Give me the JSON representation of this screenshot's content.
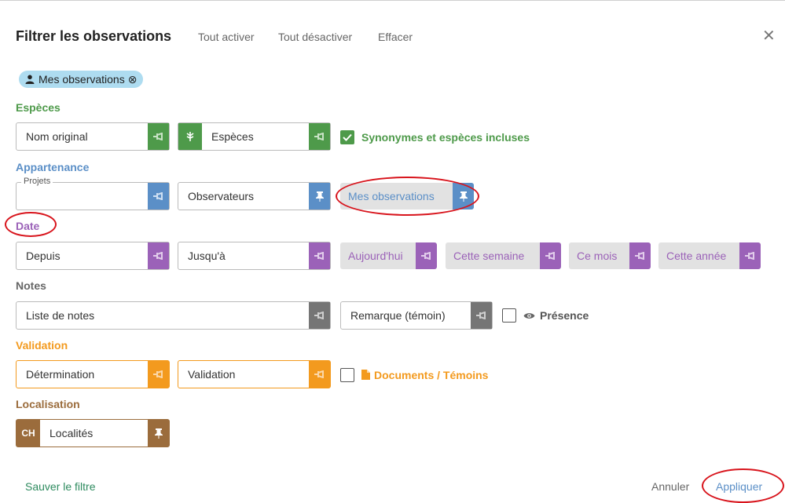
{
  "header": {
    "title": "Filtrer les observations",
    "links": [
      "Tout activer",
      "Tout désactiver",
      "Effacer"
    ],
    "close_icon": "close-icon"
  },
  "active_chip": {
    "label": "Mes observations",
    "icon": "person-icon",
    "remove_icon": "circle-x-icon"
  },
  "colors": {
    "species": "#4e9a4a",
    "membership": "#5b8fc7",
    "date": "#9b62b8",
    "notes": "#666666",
    "validation": "#f39a1e",
    "localisation": "#9b6c3c",
    "annotation_oval": "#d8141c"
  },
  "sections": {
    "especes": {
      "title": "Espèces",
      "field_original": "Nom original",
      "field_species": "Espèces",
      "checkbox_label": "Synonymes et espèces incluses",
      "checkbox_checked": true
    },
    "appartenance": {
      "title": "Appartenance",
      "field_projects_legend": "Projets",
      "field_projects_value": "",
      "field_observers": "Observateurs",
      "chip_mine": "Mes observations"
    },
    "date": {
      "title": "Date",
      "field_from": "Depuis",
      "field_to": "Jusqu'à",
      "chips": [
        "Aujourd'hui",
        "Cette semaine",
        "Ce mois",
        "Cette année"
      ]
    },
    "notes": {
      "title": "Notes",
      "field_list": "Liste de notes",
      "field_remark": "Remarque (témoin)",
      "checkbox_label": "Présence",
      "checkbox_checked": false
    },
    "validation": {
      "title": "Validation",
      "field_determination": "Détermination",
      "field_validation": "Validation",
      "checkbox_label": "Documents / Témoins",
      "checkbox_checked": false
    },
    "localisation": {
      "title": "Localisation",
      "prefix": "CH",
      "field_places": "Localités"
    }
  },
  "footer": {
    "save_filter": "Sauver le filtre",
    "cancel": "Annuler",
    "apply": "Appliquer"
  }
}
